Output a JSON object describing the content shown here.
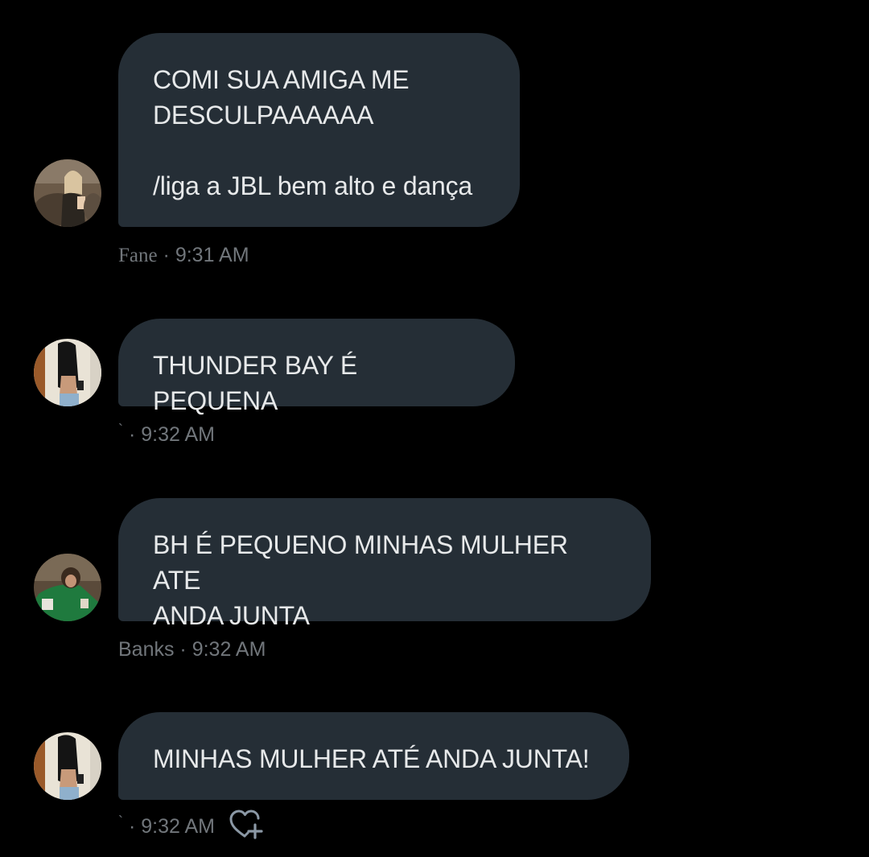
{
  "messages": [
    {
      "id": "m1",
      "text": "COMI SUA AMIGA ME\nDESCULPAAAAAA\n\n/liga a JBL bem alto e dança",
      "sender": "Fane",
      "separator": " · ",
      "time": "9:31 AM"
    },
    {
      "id": "m2",
      "text": "THUNDER BAY É PEQUENA",
      "sender": "`",
      "separator": " · ",
      "time": "9:32 AM"
    },
    {
      "id": "m3",
      "text": "BH É PEQUENO MINHAS MULHER ATE\nANDA JUNTA",
      "sender": "Banks",
      "separator": " · ",
      "time": "9:32 AM"
    },
    {
      "id": "m4",
      "text": "MINHAS MULHER ATÉ ANDA JUNTA!",
      "sender": "`",
      "separator": " · ",
      "time": "9:32 AM"
    }
  ],
  "icons": {
    "react": "heart-plus-icon"
  },
  "colors": {
    "background": "#000000",
    "bubble": "#252e36",
    "text": "#e7e9ea",
    "meta": "#71767b"
  }
}
